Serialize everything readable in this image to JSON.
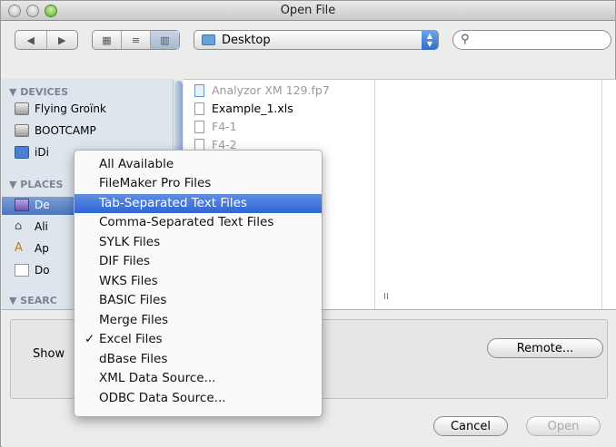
{
  "window": {
    "title": "Open File"
  },
  "toolbar": {
    "back_glyph": "◀",
    "forward_glyph": "▶",
    "view_icon_glyph": "▦",
    "view_list_glyph": "≡",
    "view_column_glyph": "▥",
    "location": "Desktop",
    "location_arrows": "▲▼",
    "search_glyph": "🔍",
    "search_value": ""
  },
  "sidebar": {
    "devices_header": "▼ DEVICES",
    "places_header": "▼ PLACES",
    "search_header": "▼ SEARC",
    "devices": [
      "Flying Groïnk",
      "BOOTCAMP",
      "iDi"
    ],
    "places": [
      "De",
      "Ali",
      "Ap",
      "Do"
    ]
  },
  "files": [
    {
      "name": "Analyzor XM 129.fp7",
      "dim": true
    },
    {
      "name": "Example_1.xls",
      "dim": false
    },
    {
      "name": "F4-1",
      "dim": true
    },
    {
      "name": "F4-2",
      "dim": true
    }
  ],
  "column_resize_glyph": "II",
  "bottom": {
    "show_label": "Show",
    "remote_button": "Remote...",
    "cancel_button": "Cancel",
    "open_button": "Open"
  },
  "menu": {
    "items": [
      {
        "label": "All Available",
        "checked": false,
        "highlighted": false
      },
      {
        "label": "FileMaker Pro Files",
        "checked": false,
        "highlighted": false
      },
      {
        "label": "Tab-Separated Text Files",
        "checked": false,
        "highlighted": true
      },
      {
        "label": "Comma-Separated Text Files",
        "checked": false,
        "highlighted": false
      },
      {
        "label": "SYLK Files",
        "checked": false,
        "highlighted": false
      },
      {
        "label": "DIF Files",
        "checked": false,
        "highlighted": false
      },
      {
        "label": "WKS Files",
        "checked": false,
        "highlighted": false
      },
      {
        "label": "BASIC Files",
        "checked": false,
        "highlighted": false
      },
      {
        "label": "Merge Files",
        "checked": false,
        "highlighted": false
      },
      {
        "label": "Excel Files",
        "checked": true,
        "highlighted": false
      },
      {
        "label": "dBase Files",
        "checked": false,
        "highlighted": false
      },
      {
        "label": "XML Data Source...",
        "checked": false,
        "highlighted": false
      },
      {
        "label": "ODBC Data Source...",
        "checked": false,
        "highlighted": false
      }
    ],
    "check_glyph": "✓"
  },
  "colors": {
    "selection": "#2f65d6",
    "sidebar_bg": "#dfe5ed"
  }
}
